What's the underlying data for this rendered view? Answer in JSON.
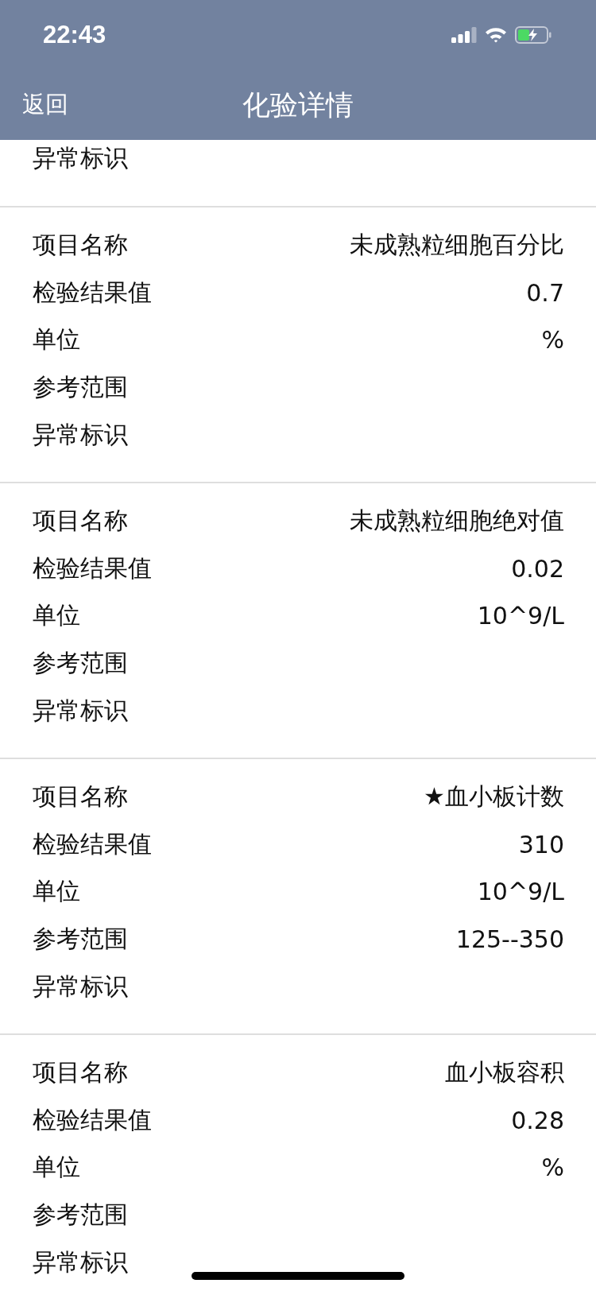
{
  "status_bar": {
    "time": "22:43"
  },
  "nav": {
    "back": "返回",
    "title": "化验详情"
  },
  "sections": [
    {
      "rows": [
        {
          "label": "异常标识"
        }
      ]
    },
    {
      "rows": [
        {
          "label": "项目名称",
          "value": "未成熟粒细胞百分比"
        },
        {
          "label": "检验结果值",
          "value": "0.7"
        },
        {
          "label": "单位",
          "value": "%"
        },
        {
          "label": "参考范围"
        },
        {
          "label": "异常标识"
        }
      ]
    },
    {
      "rows": [
        {
          "label": "项目名称",
          "value": "未成熟粒细胞绝对值"
        },
        {
          "label": "检验结果值",
          "value": "0.02"
        },
        {
          "label": "单位",
          "value": "10^9/L"
        },
        {
          "label": "参考范围"
        },
        {
          "label": "异常标识"
        }
      ]
    },
    {
      "rows": [
        {
          "label": "项目名称",
          "value": "★血小板计数"
        },
        {
          "label": "检验结果值",
          "value": "310"
        },
        {
          "label": "单位",
          "value": "10^9/L"
        },
        {
          "label": "参考范围",
          "value": "125--350"
        },
        {
          "label": "异常标识"
        }
      ]
    },
    {
      "rows": [
        {
          "label": "项目名称",
          "value": "血小板容积"
        },
        {
          "label": "检验结果值",
          "value": "0.28"
        },
        {
          "label": "单位",
          "value": "%"
        },
        {
          "label": "参考范围"
        },
        {
          "label": "异常标识"
        }
      ]
    }
  ]
}
